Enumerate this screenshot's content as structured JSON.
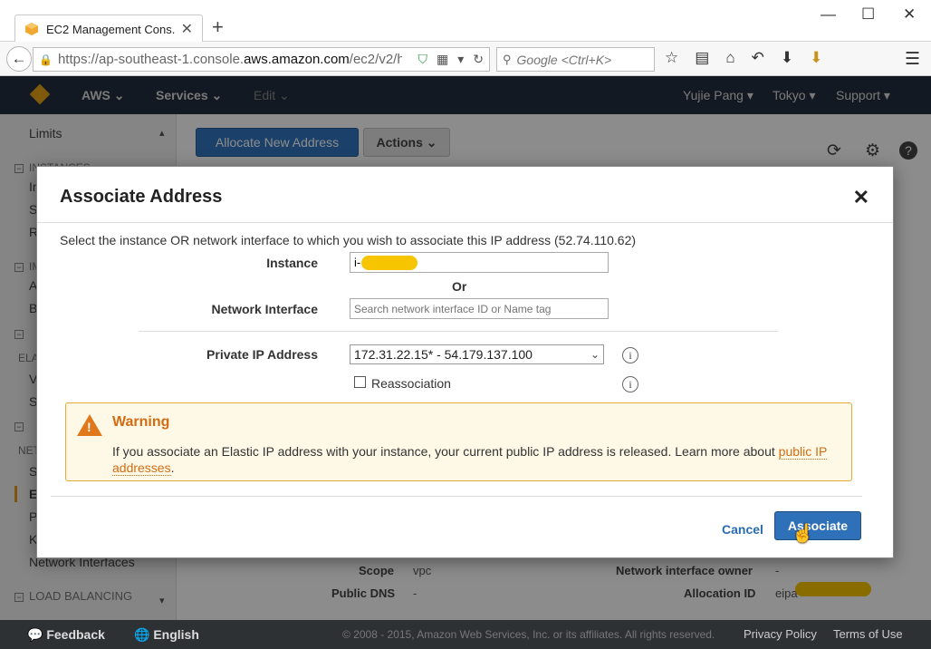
{
  "browser": {
    "tab_title": "EC2 Management Cons...",
    "url_prefix": "https://ap-southeast-1.console.",
    "url_domain": "aws.amazon.com",
    "url_suffix": "/ec2/v2/h",
    "search_placeholder": "Google <Ctrl+K>"
  },
  "aws_header": {
    "brand": "AWS",
    "services": "Services",
    "edit": "Edit",
    "user": "Yujie Pang",
    "region": "Tokyo",
    "support": "Support"
  },
  "sidebar": {
    "items": [
      "Limits",
      "In",
      "S",
      "R",
      "A",
      "B",
      "V",
      "S",
      "S",
      "E",
      "P",
      "K",
      "Network Interfaces"
    ],
    "sections": [
      "INSTANCES",
      "IM",
      "",
      "ELA",
      "",
      "NET",
      "LOAD BALANCING"
    ]
  },
  "toolbar": {
    "allocate_label": "Allocate New Address",
    "actions_label": "Actions"
  },
  "details": {
    "scope_label": "Scope",
    "scope_value": "vpc",
    "public_dns_label": "Public DNS",
    "public_dns_value": "-",
    "nio_label": "Network interface owner",
    "nio_value": "-",
    "alloc_label": "Allocation ID",
    "alloc_value": "eipa"
  },
  "modal": {
    "title": "Associate Address",
    "intro": "Select the instance OR network interface to which you wish to associate this IP address (52.74.110.62)",
    "instance_label": "Instance",
    "instance_value": "i-",
    "or_text": "Or",
    "ni_label": "Network Interface",
    "ni_placeholder": "Search network interface ID or Name tag",
    "pip_label": "Private IP Address",
    "pip_value": "172.31.22.15* - 54.179.137.100",
    "reassoc_label": "Reassociation",
    "warning_title": "Warning",
    "warning_text": "If you associate an Elastic IP address with your instance, your current public IP address is released. Learn more about ",
    "warning_link": "public IP addresses",
    "warning_end": ".",
    "cancel_label": "Cancel",
    "associate_label": "Associate"
  },
  "footer": {
    "feedback": "Feedback",
    "language": "English",
    "copyright": "© 2008 - 2015, Amazon Web Services, Inc. or its affiliates. All rights reserved.",
    "privacy": "Privacy Policy",
    "terms": "Terms of Use"
  },
  "colors": {
    "aws_header": "#232f3e",
    "primary_button": "#2f71b8",
    "warning_accent": "#d36c12",
    "redaction": "#f7c500"
  }
}
